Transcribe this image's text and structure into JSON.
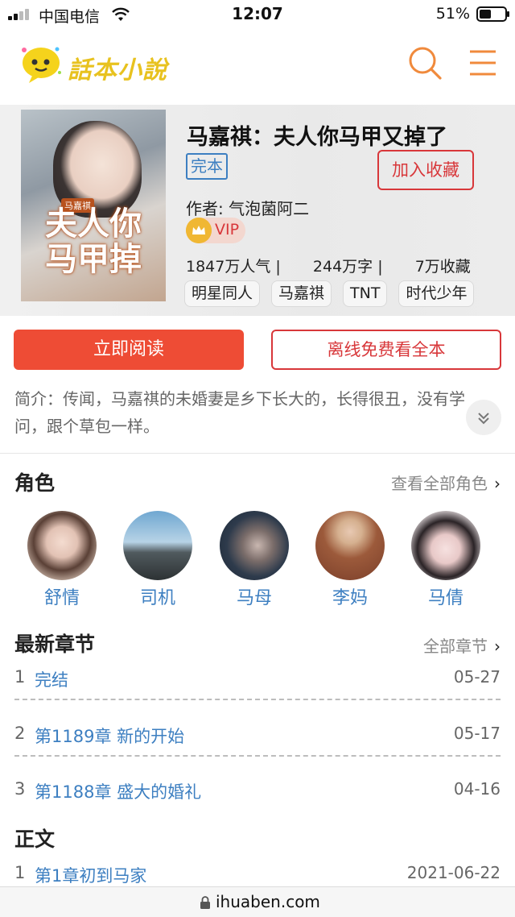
{
  "status_bar": {
    "carrier": "中国电信",
    "time": "12:07",
    "battery": "51%"
  },
  "header": {
    "logo_text": "話本小說"
  },
  "book": {
    "title": "马嘉祺：夫人你马甲又掉了",
    "status": "完本",
    "collect_label": "加入收藏",
    "author": "作者: 气泡菌阿二",
    "vip": "VIP",
    "stats": {
      "popularity": "1847万人气 |",
      "words": "244万字 |",
      "favorites": "7万收藏"
    },
    "tags": [
      "明星同人",
      "马嘉祺",
      "TNT",
      "时代少年"
    ]
  },
  "actions": {
    "read_label": "立即阅读",
    "offline_label": "离线免费看全本"
  },
  "summary": "简介：传闻，马嘉祺的未婚妻是乡下长大的，长得很丑，没有学问，跟个草包一样。",
  "roles": {
    "title": "角色",
    "more_label": "查看全部角色",
    "items": [
      {
        "name": "舒情"
      },
      {
        "name": "司机"
      },
      {
        "name": "马母"
      },
      {
        "name": "李妈"
      },
      {
        "name": "马倩"
      }
    ]
  },
  "latest": {
    "title": "最新章节",
    "more_label": "全部章节",
    "chapters": [
      {
        "num": "1",
        "title": "完结",
        "date": "05-27"
      },
      {
        "num": "2",
        "title": "第1189章 新的开始",
        "date": "05-17"
      },
      {
        "num": "3",
        "title": "第1188章 盛大的婚礼",
        "date": "04-16"
      }
    ]
  },
  "body_section": {
    "title": "正文",
    "chapters": [
      {
        "num": "1",
        "title": "第1章初到马家",
        "date": "2021-06-22"
      }
    ]
  },
  "url_bar": {
    "url": "ihuaben.com"
  }
}
